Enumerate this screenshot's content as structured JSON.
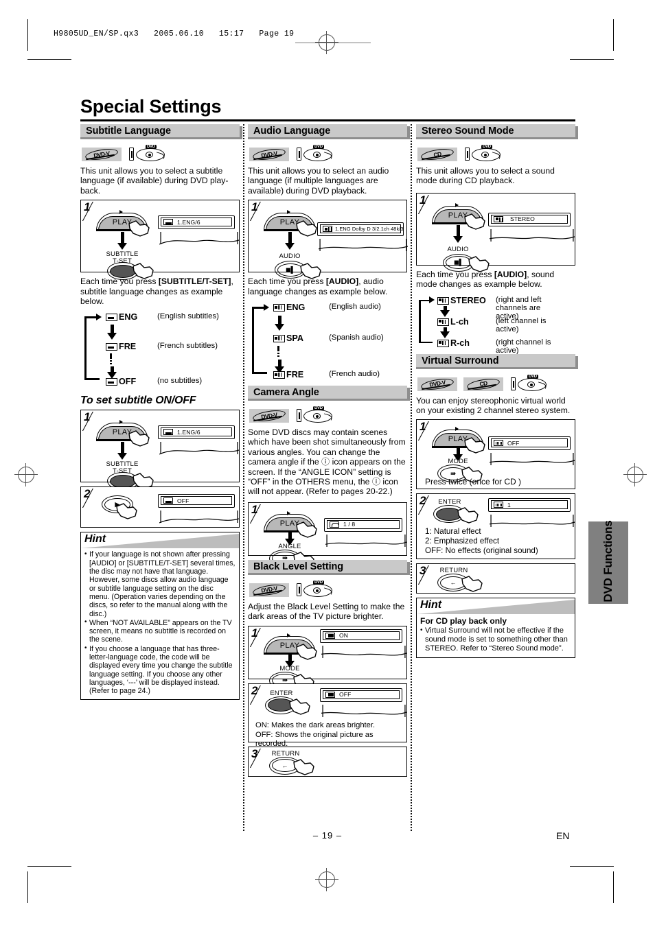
{
  "print": {
    "header_slug": "H9805UD_EN/SP.qx3   2005.06.10   15:17   Page 19",
    "page_number": "– 19 –",
    "language_mark": "EN"
  },
  "page_title": "Special Settings",
  "side_tab": "DVD Functions",
  "columns": [
    {
      "sections": [
        {
          "heading": "Subtitle Language",
          "badges": [
            "DVD-V",
            "dvd-player-icon"
          ],
          "intro": "This unit allows you to select a subtitle language (if available) during DVD play-back.",
          "steps": [
            {
              "number": "1",
              "button_top": "PLAY",
              "button_bottom_label": "SUBTITLE\nT-SET",
              "osd_text": "1.ENG/6",
              "osd_icon": "subtitle-icon"
            }
          ],
          "cycle_intro_pre": "Each time you press ",
          "cycle_intro_key": "[SUBTITLE/T-SET]",
          "cycle_intro_post": ", subtitle language changes as example below.",
          "cycle": [
            {
              "icon": "subtitle-icon",
              "name": "ENG",
              "desc": "(English subtitles)"
            },
            {
              "icon": "subtitle-icon",
              "name": "FRE",
              "desc": "(French subtitles)"
            },
            {
              "icon": "subtitle-icon",
              "name": "OFF",
              "desc": "(no subtitles)"
            }
          ]
        },
        {
          "subhead": "To set subtitle ON/OFF",
          "steps": [
            {
              "number": "1",
              "button_top": "PLAY",
              "button_bottom_label": "SUBTITLE\nT-SET",
              "osd_text": "1.ENG/6",
              "osd_icon": "subtitle-icon"
            },
            {
              "number": "2",
              "button_top": "",
              "button_bottom_label": "",
              "osd_text": "OFF",
              "osd_icon": "subtitle-icon"
            }
          ]
        }
      ],
      "hint": {
        "title": "Hint",
        "items": [
          "If your language is not shown after pressing [AUDIO] or [SUBTITLE/T-SET] several times, the disc may not have that language. However, some discs allow audio language or subtitle language setting on the disc menu. (Operation varies depending on the discs, so refer to the manual along with the disc.)",
          "When “NOT AVAILABLE” appears on the TV screen, it means no subtitle is recorded on the scene.",
          "If you choose a language that has three-letter-language code, the code will be displayed every time you change the subtitle language setting. If you choose any other languages, ‘---’ will be displayed instead. (Refer to page 24.)"
        ]
      }
    },
    {
      "sections": [
        {
          "heading": "Audio Language",
          "badges": [
            "DVD-V",
            "dvd-player-icon"
          ],
          "intro": "This unit allows you to select an audio language (if multiple languages are available) during DVD playback.",
          "steps": [
            {
              "number": "1",
              "button_top": "PLAY",
              "button_bottom_label": "AUDIO",
              "osd_text": "1.ENG  Dolby D  3/2.1ch  48k/3",
              "osd_icon": "audio-icon"
            }
          ],
          "cycle_intro_pre": "Each time you press ",
          "cycle_intro_key": "[AUDIO]",
          "cycle_intro_post": ", audio language changes as example below.",
          "cycle": [
            {
              "icon": "audio-icon",
              "name": "ENG",
              "desc": "(English audio)"
            },
            {
              "icon": "audio-icon",
              "name": "SPA",
              "desc": "(Spanish audio)"
            },
            {
              "icon": "audio-icon",
              "name": "FRE",
              "desc": "(French audio)"
            }
          ]
        },
        {
          "heading": "Camera Angle",
          "badges": [
            "DVD-V",
            "dvd-player-icon"
          ],
          "intro": "Some DVD discs may contain scenes which have been shot simultaneously from various angles. You can change the camera angle if the ⓘ icon appears on the screen. If the “ANGLE ICON” setting is “OFF” in the OTHERS menu, the ⓘ icon will not appear. (Refer to pages 20-22.)",
          "steps": [
            {
              "number": "1",
              "button_top": "PLAY",
              "button_bottom_label": "ANGLE",
              "osd_text": "1 / 8",
              "osd_icon": "angle-icon"
            }
          ]
        },
        {
          "heading": "Black Level Setting",
          "badges": [
            "DVD-V",
            "dvd-player-icon"
          ],
          "intro": "Adjust the Black Level Setting to make the dark areas of the TV picture brighter.",
          "steps": [
            {
              "number": "1",
              "button_top": "PLAY",
              "button_bottom_label": "MODE",
              "osd_text": "ON",
              "osd_icon": "black-level-icon"
            },
            {
              "number": "2",
              "button_top": "",
              "button_bottom_label": "ENTER",
              "osd_text": "OFF",
              "osd_icon": "black-level-icon",
              "notes": [
                "ON: Makes the dark areas brighter.",
                "OFF: Shows the original picture as recorded."
              ]
            },
            {
              "number": "3",
              "button_top": "",
              "button_bottom_label": "RETURN",
              "osd_text": "",
              "osd_icon": ""
            }
          ]
        }
      ]
    },
    {
      "sections": [
        {
          "heading": "Stereo Sound Mode",
          "badges": [
            "CD",
            "dvd-player-icon"
          ],
          "intro": "This unit allows you to select a sound mode during CD playback.",
          "steps": [
            {
              "number": "1",
              "button_top": "PLAY",
              "button_bottom_label": "AUDIO",
              "osd_text": "STEREO",
              "osd_icon": "audio-icon"
            }
          ],
          "cycle_intro_pre": "Each time you press ",
          "cycle_intro_key": "[AUDIO]",
          "cycle_intro_post": ", sound mode changes as example below.",
          "cycle": [
            {
              "icon": "audio-icon",
              "name": "STEREO",
              "desc": "(right and left channels are active)"
            },
            {
              "icon": "audio-icon",
              "name": "L-ch",
              "desc": "(left channel is active)"
            },
            {
              "icon": "audio-icon",
              "name": "R-ch",
              "desc": "(right channel is active)"
            }
          ]
        },
        {
          "heading": "Virtual Surround",
          "badges": [
            "DVD-V",
            "CD",
            "dvd-player-icon"
          ],
          "intro": "You can enjoy stereophonic virtual world on your existing 2 channel stereo system.",
          "steps": [
            {
              "number": "1",
              "button_top": "PLAY",
              "button_bottom_label": "MODE",
              "osd_text": "OFF",
              "osd_icon": "virtual-surround-icon",
              "notes": [
                "Press twice (once for CD )"
              ]
            },
            {
              "number": "2",
              "button_top": "",
              "button_bottom_label": "ENTER",
              "osd_text": "1",
              "osd_icon": "virtual-surround-icon",
              "notes": [
                "1: Natural effect",
                "2: Emphasized effect",
                "OFF: No effects (original sound)"
              ]
            },
            {
              "number": "3",
              "button_top": "",
              "button_bottom_label": "RETURN",
              "osd_text": "",
              "osd_icon": ""
            }
          ]
        }
      ],
      "hint": {
        "title": "Hint",
        "subtitle": "For CD play back only",
        "items": [
          "Virtual Surround will not be effective if the sound mode is set to something other than STEREO. Refer to “Stereo Sound mode”."
        ]
      }
    }
  ]
}
